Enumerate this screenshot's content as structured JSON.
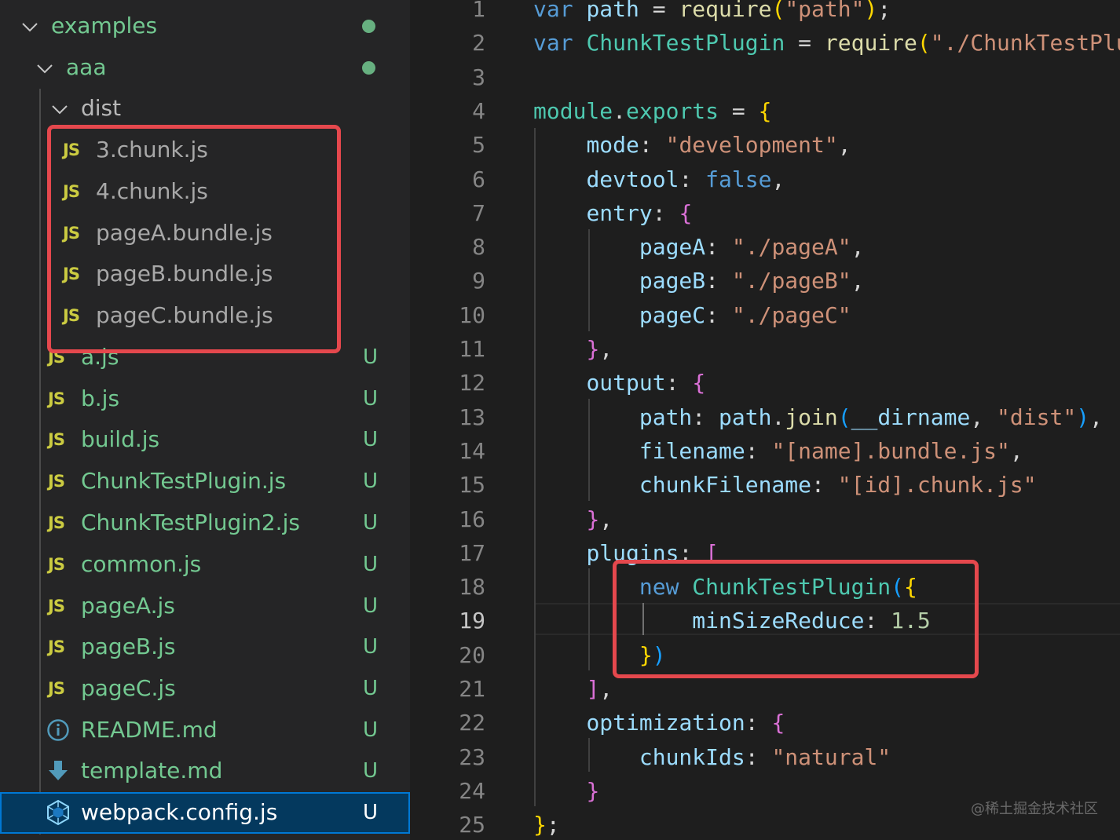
{
  "explorer": {
    "folder_examples": {
      "label": "examples"
    },
    "folder_aaa": {
      "label": "aaa"
    },
    "folder_dist": {
      "label": "dist"
    },
    "dist_files": [
      {
        "label": "3.chunk.js",
        "icon": "JS"
      },
      {
        "label": "4.chunk.js",
        "icon": "JS"
      },
      {
        "label": "pageA.bundle.js",
        "icon": "JS"
      },
      {
        "label": "pageB.bundle.js",
        "icon": "JS"
      },
      {
        "label": "pageC.bundle.js",
        "icon": "JS"
      }
    ],
    "files": [
      {
        "label": "a.js",
        "icon": "JS",
        "status": "U"
      },
      {
        "label": "b.js",
        "icon": "JS",
        "status": "U"
      },
      {
        "label": "build.js",
        "icon": "JS",
        "status": "U"
      },
      {
        "label": "ChunkTestPlugin.js",
        "icon": "JS",
        "status": "U"
      },
      {
        "label": "ChunkTestPlugin2.js",
        "icon": "JS",
        "status": "U"
      },
      {
        "label": "common.js",
        "icon": "JS",
        "status": "U"
      },
      {
        "label": "pageA.js",
        "icon": "JS",
        "status": "U"
      },
      {
        "label": "pageB.js",
        "icon": "JS",
        "status": "U"
      },
      {
        "label": "pageC.js",
        "icon": "JS",
        "status": "U"
      },
      {
        "label": "README.md",
        "icon": "info-icon",
        "status": "U"
      },
      {
        "label": "template.md",
        "icon": "download-arrow-icon",
        "status": "U"
      },
      {
        "label": "webpack.config.js",
        "icon": "webpack-cube-icon",
        "status": "U"
      }
    ]
  },
  "editor": {
    "active_line": "19",
    "lines": [
      {
        "n": "1",
        "t": [
          [
            "kw",
            "var "
          ],
          [
            "var",
            "path"
          ],
          [
            "pl",
            " = "
          ],
          [
            "fn",
            "require"
          ],
          [
            "p1",
            "("
          ],
          [
            "str",
            "\"path\""
          ],
          [
            "p1",
            ")"
          ],
          [
            "pl",
            ";"
          ]
        ]
      },
      {
        "n": "2",
        "t": [
          [
            "kw",
            "var "
          ],
          [
            "cls",
            "ChunkTestPlugin"
          ],
          [
            "pl",
            " = "
          ],
          [
            "fn",
            "require"
          ],
          [
            "p1",
            "("
          ],
          [
            "str",
            "\"./ChunkTestPlugin\""
          ],
          [
            "p1",
            ")"
          ],
          [
            "pl",
            ";"
          ]
        ]
      },
      {
        "n": "3",
        "t": []
      },
      {
        "n": "4",
        "t": [
          [
            "cls",
            "module"
          ],
          [
            "pl",
            "."
          ],
          [
            "cls",
            "exports"
          ],
          [
            "pl",
            " = "
          ],
          [
            "p1",
            "{"
          ]
        ]
      },
      {
        "n": "5",
        "t": [
          [
            "pl",
            "    "
          ],
          [
            "prop",
            "mode"
          ],
          [
            "pl",
            ": "
          ],
          [
            "str",
            "\"development\""
          ],
          [
            "pl",
            ","
          ]
        ]
      },
      {
        "n": "6",
        "t": [
          [
            "pl",
            "    "
          ],
          [
            "prop",
            "devtool"
          ],
          [
            "pl",
            ": "
          ],
          [
            "kw",
            "false"
          ],
          [
            "pl",
            ","
          ]
        ]
      },
      {
        "n": "7",
        "t": [
          [
            "pl",
            "    "
          ],
          [
            "prop",
            "entry"
          ],
          [
            "pl",
            ": "
          ],
          [
            "p2",
            "{"
          ]
        ]
      },
      {
        "n": "8",
        "t": [
          [
            "pl",
            "        "
          ],
          [
            "prop",
            "pageA"
          ],
          [
            "pl",
            ": "
          ],
          [
            "str",
            "\"./pageA\""
          ],
          [
            "pl",
            ","
          ]
        ]
      },
      {
        "n": "9",
        "t": [
          [
            "pl",
            "        "
          ],
          [
            "prop",
            "pageB"
          ],
          [
            "pl",
            ": "
          ],
          [
            "str",
            "\"./pageB\""
          ],
          [
            "pl",
            ","
          ]
        ]
      },
      {
        "n": "10",
        "t": [
          [
            "pl",
            "        "
          ],
          [
            "prop",
            "pageC"
          ],
          [
            "pl",
            ": "
          ],
          [
            "str",
            "\"./pageC\""
          ]
        ]
      },
      {
        "n": "11",
        "t": [
          [
            "pl",
            "    "
          ],
          [
            "p2",
            "}"
          ],
          [
            "pl",
            ","
          ]
        ]
      },
      {
        "n": "12",
        "t": [
          [
            "pl",
            "    "
          ],
          [
            "prop",
            "output"
          ],
          [
            "pl",
            ": "
          ],
          [
            "p2",
            "{"
          ]
        ]
      },
      {
        "n": "13",
        "t": [
          [
            "pl",
            "        "
          ],
          [
            "prop",
            "path"
          ],
          [
            "pl",
            ": "
          ],
          [
            "var",
            "path"
          ],
          [
            "pl",
            "."
          ],
          [
            "fn",
            "join"
          ],
          [
            "p3",
            "("
          ],
          [
            "var",
            "__dirname"
          ],
          [
            "pl",
            ", "
          ],
          [
            "str",
            "\"dist\""
          ],
          [
            "p3",
            ")"
          ],
          [
            "pl",
            ","
          ]
        ]
      },
      {
        "n": "14",
        "t": [
          [
            "pl",
            "        "
          ],
          [
            "prop",
            "filename"
          ],
          [
            "pl",
            ": "
          ],
          [
            "str",
            "\"[name].bundle.js\""
          ],
          [
            "pl",
            ","
          ]
        ]
      },
      {
        "n": "15",
        "t": [
          [
            "pl",
            "        "
          ],
          [
            "prop",
            "chunkFilename"
          ],
          [
            "pl",
            ": "
          ],
          [
            "str",
            "\"[id].chunk.js\""
          ]
        ]
      },
      {
        "n": "16",
        "t": [
          [
            "pl",
            "    "
          ],
          [
            "p2",
            "}"
          ],
          [
            "pl",
            ","
          ]
        ]
      },
      {
        "n": "17",
        "t": [
          [
            "pl",
            "    "
          ],
          [
            "prop",
            "plugins"
          ],
          [
            "pl",
            ": "
          ],
          [
            "p2",
            "["
          ]
        ]
      },
      {
        "n": "18",
        "t": [
          [
            "pl",
            "        "
          ],
          [
            "kw",
            "new "
          ],
          [
            "cls",
            "ChunkTestPlugin"
          ],
          [
            "p3",
            "("
          ],
          [
            "p1",
            "{"
          ]
        ]
      },
      {
        "n": "19",
        "t": [
          [
            "pl",
            "            "
          ],
          [
            "prop",
            "minSizeReduce"
          ],
          [
            "pl",
            ": "
          ],
          [
            "num",
            "1.5"
          ]
        ]
      },
      {
        "n": "20",
        "t": [
          [
            "pl",
            "        "
          ],
          [
            "p1",
            "}"
          ],
          [
            "p3",
            ")"
          ]
        ]
      },
      {
        "n": "21",
        "t": [
          [
            "pl",
            "    "
          ],
          [
            "p2",
            "]"
          ],
          [
            "pl",
            ","
          ]
        ]
      },
      {
        "n": "22",
        "t": [
          [
            "pl",
            "    "
          ],
          [
            "prop",
            "optimization"
          ],
          [
            "pl",
            ": "
          ],
          [
            "p2",
            "{"
          ]
        ]
      },
      {
        "n": "23",
        "t": [
          [
            "pl",
            "        "
          ],
          [
            "prop",
            "chunkIds"
          ],
          [
            "pl",
            ": "
          ],
          [
            "str",
            "\"natural\""
          ]
        ]
      },
      {
        "n": "24",
        "t": [
          [
            "pl",
            "    "
          ],
          [
            "p2",
            "}"
          ]
        ]
      },
      {
        "n": "25",
        "t": [
          [
            "p1",
            "}"
          ],
          [
            "pl",
            ";"
          ]
        ]
      }
    ]
  },
  "watermark": "@稀土掘金技术社区",
  "colors": {
    "highlight_box": "#e5484d",
    "untracked": "#73c991",
    "js_icon": "#cbcb41",
    "selection_bg": "#04395e",
    "selection_border": "#0078d4"
  }
}
